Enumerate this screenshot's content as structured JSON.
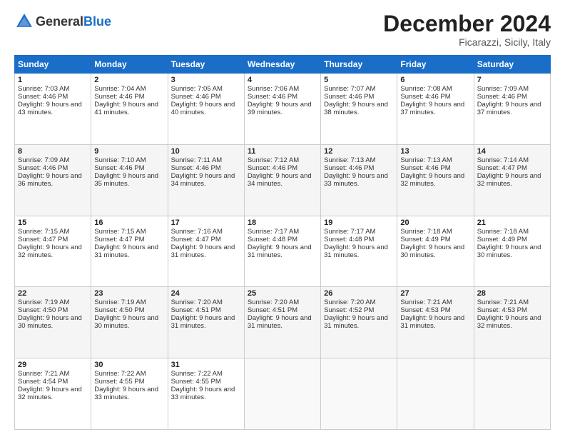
{
  "header": {
    "logo_general": "General",
    "logo_blue": "Blue",
    "title": "December 2024",
    "subtitle": "Ficarazzi, Sicily, Italy"
  },
  "calendar": {
    "headers": [
      "Sunday",
      "Monday",
      "Tuesday",
      "Wednesday",
      "Thursday",
      "Friday",
      "Saturday"
    ],
    "rows": [
      [
        {
          "day": "1",
          "sunrise": "Sunrise: 7:03 AM",
          "sunset": "Sunset: 4:46 PM",
          "daylight": "Daylight: 9 hours and 43 minutes."
        },
        {
          "day": "2",
          "sunrise": "Sunrise: 7:04 AM",
          "sunset": "Sunset: 4:46 PM",
          "daylight": "Daylight: 9 hours and 41 minutes."
        },
        {
          "day": "3",
          "sunrise": "Sunrise: 7:05 AM",
          "sunset": "Sunset: 4:46 PM",
          "daylight": "Daylight: 9 hours and 40 minutes."
        },
        {
          "day": "4",
          "sunrise": "Sunrise: 7:06 AM",
          "sunset": "Sunset: 4:46 PM",
          "daylight": "Daylight: 9 hours and 39 minutes."
        },
        {
          "day": "5",
          "sunrise": "Sunrise: 7:07 AM",
          "sunset": "Sunset: 4:46 PM",
          "daylight": "Daylight: 9 hours and 38 minutes."
        },
        {
          "day": "6",
          "sunrise": "Sunrise: 7:08 AM",
          "sunset": "Sunset: 4:46 PM",
          "daylight": "Daylight: 9 hours and 37 minutes."
        },
        {
          "day": "7",
          "sunrise": "Sunrise: 7:09 AM",
          "sunset": "Sunset: 4:46 PM",
          "daylight": "Daylight: 9 hours and 37 minutes."
        }
      ],
      [
        {
          "day": "8",
          "sunrise": "Sunrise: 7:09 AM",
          "sunset": "Sunset: 4:46 PM",
          "daylight": "Daylight: 9 hours and 36 minutes."
        },
        {
          "day": "9",
          "sunrise": "Sunrise: 7:10 AM",
          "sunset": "Sunset: 4:46 PM",
          "daylight": "Daylight: 9 hours and 35 minutes."
        },
        {
          "day": "10",
          "sunrise": "Sunrise: 7:11 AM",
          "sunset": "Sunset: 4:46 PM",
          "daylight": "Daylight: 9 hours and 34 minutes."
        },
        {
          "day": "11",
          "sunrise": "Sunrise: 7:12 AM",
          "sunset": "Sunset: 4:46 PM",
          "daylight": "Daylight: 9 hours and 34 minutes."
        },
        {
          "day": "12",
          "sunrise": "Sunrise: 7:13 AM",
          "sunset": "Sunset: 4:46 PM",
          "daylight": "Daylight: 9 hours and 33 minutes."
        },
        {
          "day": "13",
          "sunrise": "Sunrise: 7:13 AM",
          "sunset": "Sunset: 4:46 PM",
          "daylight": "Daylight: 9 hours and 32 minutes."
        },
        {
          "day": "14",
          "sunrise": "Sunrise: 7:14 AM",
          "sunset": "Sunset: 4:47 PM",
          "daylight": "Daylight: 9 hours and 32 minutes."
        }
      ],
      [
        {
          "day": "15",
          "sunrise": "Sunrise: 7:15 AM",
          "sunset": "Sunset: 4:47 PM",
          "daylight": "Daylight: 9 hours and 32 minutes."
        },
        {
          "day": "16",
          "sunrise": "Sunrise: 7:15 AM",
          "sunset": "Sunset: 4:47 PM",
          "daylight": "Daylight: 9 hours and 31 minutes."
        },
        {
          "day": "17",
          "sunrise": "Sunrise: 7:16 AM",
          "sunset": "Sunset: 4:47 PM",
          "daylight": "Daylight: 9 hours and 31 minutes."
        },
        {
          "day": "18",
          "sunrise": "Sunrise: 7:17 AM",
          "sunset": "Sunset: 4:48 PM",
          "daylight": "Daylight: 9 hours and 31 minutes."
        },
        {
          "day": "19",
          "sunrise": "Sunrise: 7:17 AM",
          "sunset": "Sunset: 4:48 PM",
          "daylight": "Daylight: 9 hours and 31 minutes."
        },
        {
          "day": "20",
          "sunrise": "Sunrise: 7:18 AM",
          "sunset": "Sunset: 4:49 PM",
          "daylight": "Daylight: 9 hours and 30 minutes."
        },
        {
          "day": "21",
          "sunrise": "Sunrise: 7:18 AM",
          "sunset": "Sunset: 4:49 PM",
          "daylight": "Daylight: 9 hours and 30 minutes."
        }
      ],
      [
        {
          "day": "22",
          "sunrise": "Sunrise: 7:19 AM",
          "sunset": "Sunset: 4:50 PM",
          "daylight": "Daylight: 9 hours and 30 minutes."
        },
        {
          "day": "23",
          "sunrise": "Sunrise: 7:19 AM",
          "sunset": "Sunset: 4:50 PM",
          "daylight": "Daylight: 9 hours and 30 minutes."
        },
        {
          "day": "24",
          "sunrise": "Sunrise: 7:20 AM",
          "sunset": "Sunset: 4:51 PM",
          "daylight": "Daylight: 9 hours and 31 minutes."
        },
        {
          "day": "25",
          "sunrise": "Sunrise: 7:20 AM",
          "sunset": "Sunset: 4:51 PM",
          "daylight": "Daylight: 9 hours and 31 minutes."
        },
        {
          "day": "26",
          "sunrise": "Sunrise: 7:20 AM",
          "sunset": "Sunset: 4:52 PM",
          "daylight": "Daylight: 9 hours and 31 minutes."
        },
        {
          "day": "27",
          "sunrise": "Sunrise: 7:21 AM",
          "sunset": "Sunset: 4:53 PM",
          "daylight": "Daylight: 9 hours and 31 minutes."
        },
        {
          "day": "28",
          "sunrise": "Sunrise: 7:21 AM",
          "sunset": "Sunset: 4:53 PM",
          "daylight": "Daylight: 9 hours and 32 minutes."
        }
      ],
      [
        {
          "day": "29",
          "sunrise": "Sunrise: 7:21 AM",
          "sunset": "Sunset: 4:54 PM",
          "daylight": "Daylight: 9 hours and 32 minutes."
        },
        {
          "day": "30",
          "sunrise": "Sunrise: 7:22 AM",
          "sunset": "Sunset: 4:55 PM",
          "daylight": "Daylight: 9 hours and 33 minutes."
        },
        {
          "day": "31",
          "sunrise": "Sunrise: 7:22 AM",
          "sunset": "Sunset: 4:55 PM",
          "daylight": "Daylight: 9 hours and 33 minutes."
        },
        null,
        null,
        null,
        null
      ]
    ]
  }
}
